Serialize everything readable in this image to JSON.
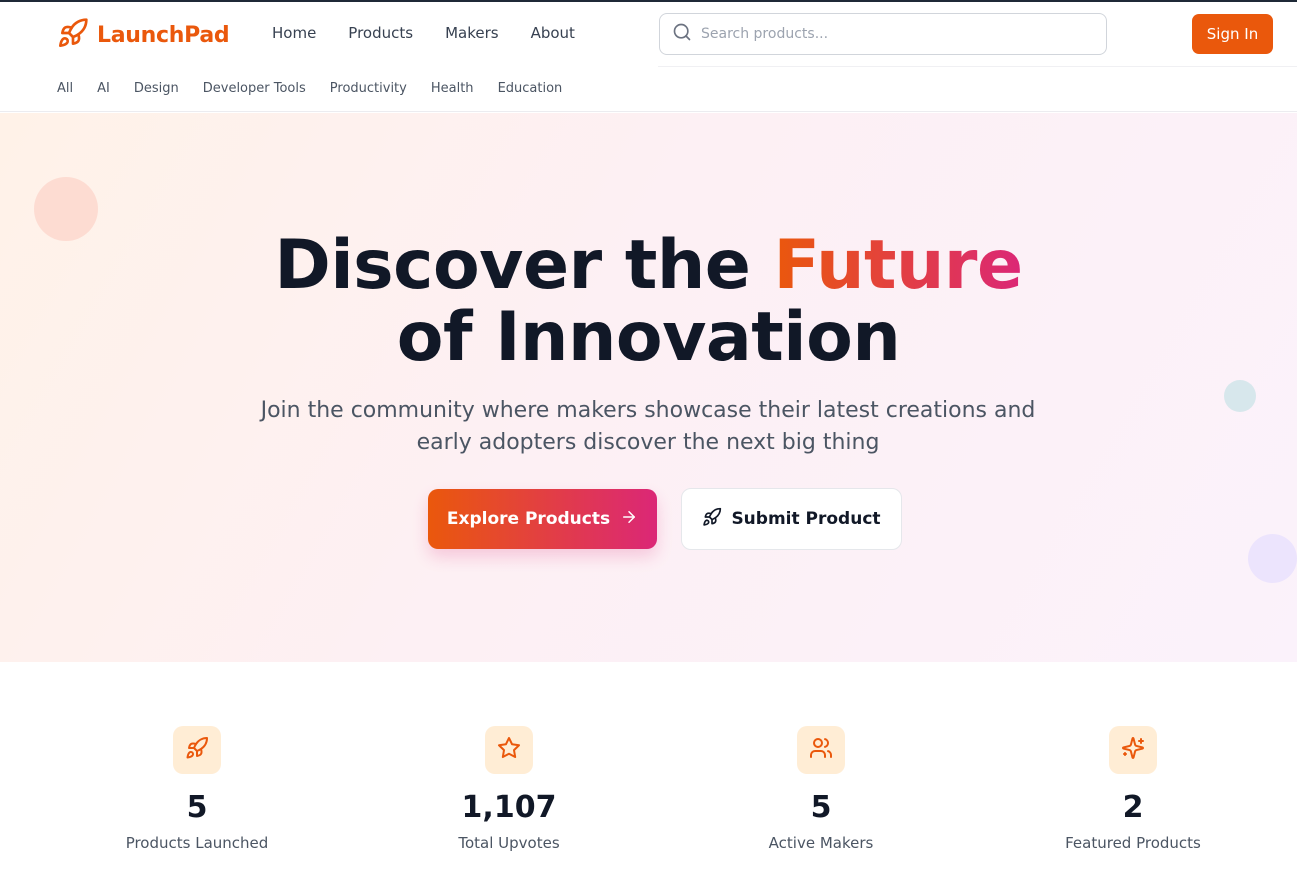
{
  "brand": {
    "name": "LaunchPad",
    "icon": "rocket-icon",
    "color": "#ea580c"
  },
  "nav": {
    "links": [
      "Home",
      "Products",
      "Makers",
      "About"
    ]
  },
  "search": {
    "placeholder": "Search products...",
    "icon": "search-icon"
  },
  "auth": {
    "sign_in_label": "Sign In"
  },
  "categories": [
    "All",
    "AI",
    "Design",
    "Developer Tools",
    "Productivity",
    "Health",
    "Education"
  ],
  "hero": {
    "title_part1": "Discover the ",
    "title_accent": "Future",
    "title_part2": "of Innovation",
    "subtitle": "Join the community where makers showcase their latest creations and early adopters discover the next big thing",
    "primary_cta": "Explore Products",
    "secondary_cta": "Submit Product"
  },
  "stats": [
    {
      "value": "5",
      "label": "Products Launched",
      "icon": "rocket-icon"
    },
    {
      "value": "1,107",
      "label": "Total Upvotes",
      "icon": "star-icon"
    },
    {
      "value": "5",
      "label": "Active Makers",
      "icon": "users-icon"
    },
    {
      "value": "2",
      "label": "Featured Products",
      "icon": "sparkles-icon"
    }
  ],
  "colors": {
    "accent_start": "#ea580c",
    "accent_end": "#db2777",
    "text_dark": "#111827",
    "text_muted": "#4b5563"
  }
}
